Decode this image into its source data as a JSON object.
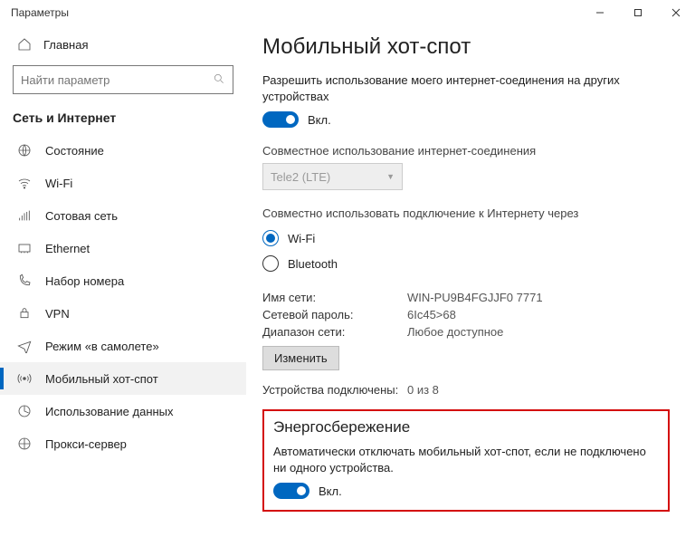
{
  "window": {
    "title": "Параметры"
  },
  "sidebar": {
    "home": "Главная",
    "search_placeholder": "Найти параметр",
    "section": "Сеть и Интернет",
    "items": [
      {
        "label": "Состояние"
      },
      {
        "label": "Wi-Fi"
      },
      {
        "label": "Сотовая сеть"
      },
      {
        "label": "Ethernet"
      },
      {
        "label": "Набор номера"
      },
      {
        "label": "VPN"
      },
      {
        "label": "Режим «в самолете»"
      },
      {
        "label": "Мобильный хот-спот"
      },
      {
        "label": "Использование данных"
      },
      {
        "label": "Прокси-сервер"
      }
    ]
  },
  "content": {
    "title": "Мобильный хот-спот",
    "share_desc": "Разрешить использование моего интернет-соединения на других устройствах",
    "toggle_on": "Вкл.",
    "share_conn_label": "Совместное использование интернет-соединения",
    "share_conn_value": "Tele2 (LTE)",
    "share_via_label": "Совместно использовать подключение к Интернету через",
    "radio_wifi": "Wi-Fi",
    "radio_bt": "Bluetooth",
    "net_name_label": "Имя сети:",
    "net_name_value": "WIN-PU9B4FGJJF0 7771",
    "net_pass_label": "Сетевой пароль:",
    "net_pass_value": "6Ic45>68",
    "net_band_label": "Диапазон сети:",
    "net_band_value": "Любое доступное",
    "edit_btn": "Изменить",
    "devices_label": "Устройства подключены:",
    "devices_value": "0 из 8",
    "power_title": "Энергосбережение",
    "power_desc": "Автоматически отключать мобильный хот-спот, если не подключено ни одного устройства.",
    "power_toggle": "Вкл."
  }
}
